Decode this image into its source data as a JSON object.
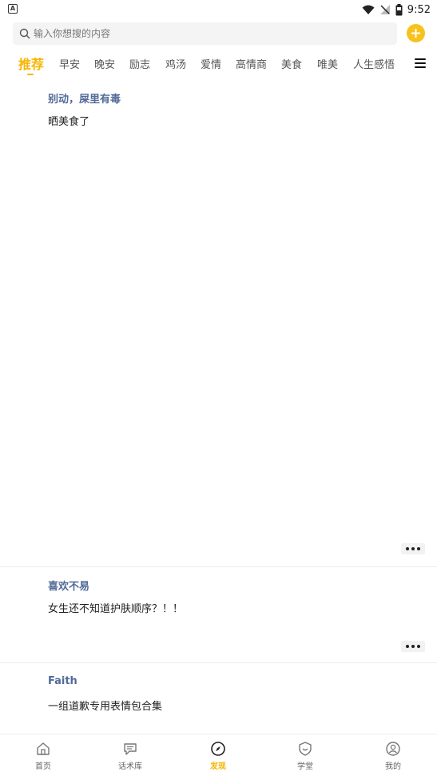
{
  "status_bar": {
    "left_icon": "A",
    "time": "9:52",
    "icons": [
      "wifi-icon",
      "no-signal-icon",
      "battery-icon"
    ]
  },
  "search": {
    "placeholder": "输入你想搜的内容",
    "value": ""
  },
  "add_button_icon": "plus-icon",
  "accent_color": "#f7b500",
  "tabs": [
    {
      "label": "推荐",
      "active": true
    },
    {
      "label": "早安"
    },
    {
      "label": "晚安"
    },
    {
      "label": "励志"
    },
    {
      "label": "鸡汤"
    },
    {
      "label": "爱情"
    },
    {
      "label": "高情商"
    },
    {
      "label": "美食"
    },
    {
      "label": "唯美"
    },
    {
      "label": "人生感悟"
    }
  ],
  "feed": [
    {
      "author": "别动，屎里有毒",
      "text": "晒美食了"
    },
    {
      "author": "喜欢不易",
      "text": "女生还不知道护肤顺序？！！"
    },
    {
      "author": "Faith",
      "text": "一组道歉专用表情包合集"
    }
  ],
  "bottom_nav": [
    {
      "label": "首页",
      "icon": "home-icon"
    },
    {
      "label": "话术库",
      "icon": "chat-icon"
    },
    {
      "label": "发现",
      "icon": "compass-icon",
      "active": true
    },
    {
      "label": "学堂",
      "icon": "shield-icon"
    },
    {
      "label": "我的",
      "icon": "profile-icon"
    }
  ]
}
